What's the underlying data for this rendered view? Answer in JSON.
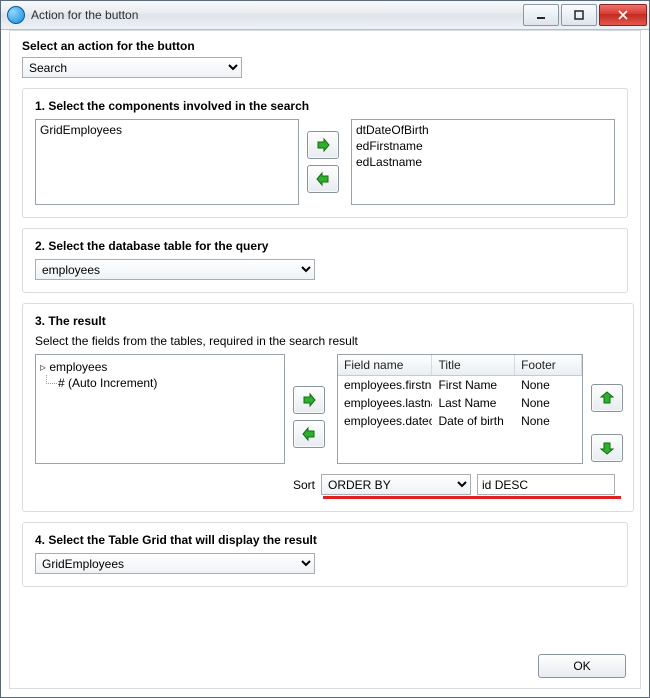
{
  "window": {
    "title": "Action for the button"
  },
  "header": {
    "label": "Select an action for the button",
    "action": "Search"
  },
  "section1": {
    "title": "1. Select the components involved in the search",
    "left": [
      "GridEmployees"
    ],
    "right": [
      "dtDateOfBirth",
      "edFirstname",
      "edLastname"
    ]
  },
  "section2": {
    "title": "2. Select the database table for the query",
    "table": "employees"
  },
  "section3": {
    "title": "3. The result",
    "note": "Select the fields from the tables, required in the search result",
    "tree": {
      "root": "employees",
      "child": "# (Auto Increment)"
    },
    "columns": {
      "field": "Field name",
      "title": "Title",
      "footer": "Footer"
    },
    "rows": [
      {
        "field": "employees.firstname",
        "title": "First Name",
        "footer": "None"
      },
      {
        "field": "employees.lastname",
        "title": "Last Name",
        "footer": "None"
      },
      {
        "field": "employees.dateofbirth",
        "title": "Date of birth",
        "footer": "None"
      }
    ],
    "sort": {
      "label": "Sort",
      "clause": "ORDER BY",
      "value": "id DESC"
    }
  },
  "section4": {
    "title": "4. Select the Table Grid that will display the result",
    "grid": "GridEmployees"
  },
  "buttons": {
    "ok": "OK"
  }
}
